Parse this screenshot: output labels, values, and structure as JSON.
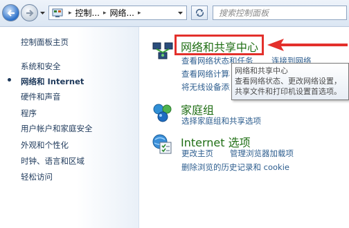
{
  "navbar": {
    "breadcrumb": [
      "控制...",
      "网络..."
    ],
    "search_placeholder": "搜索控制面板"
  },
  "sidebar": {
    "items": [
      {
        "label": "控制面板主页"
      },
      {
        "label": "系统和安全"
      },
      {
        "label": "网络和 Internet",
        "current": true
      },
      {
        "label": "硬件和声音"
      },
      {
        "label": "程序"
      },
      {
        "label": "用户帐户和家庭安全"
      },
      {
        "label": "外观和个性化"
      },
      {
        "label": "时钟、语言和区域"
      },
      {
        "label": "轻松访问"
      }
    ]
  },
  "categories": {
    "network_center": {
      "title": "网络和共享中心",
      "links": [
        "查看网络状态和任务",
        "连接到网络",
        "查看网络计算机和设备",
        "将无线设备添加到网络"
      ]
    },
    "homegroup": {
      "title": "家庭组",
      "links": [
        "选择家庭组和共享选项"
      ]
    },
    "internet_options": {
      "title": "Internet 选项",
      "links": [
        "更改主页",
        "管理浏览器加载项",
        "删除浏览的历史记录和 cookie"
      ]
    }
  },
  "tooltip": {
    "title": "网络和共享中心",
    "line1": "查看网络状态、更改网络设置，",
    "line2": "共享文件和打印机设置首选项。"
  },
  "colors": {
    "annotation_red": "#e3302b",
    "category_green": "#1f6e14",
    "link_blue": "#2e5e8f"
  }
}
